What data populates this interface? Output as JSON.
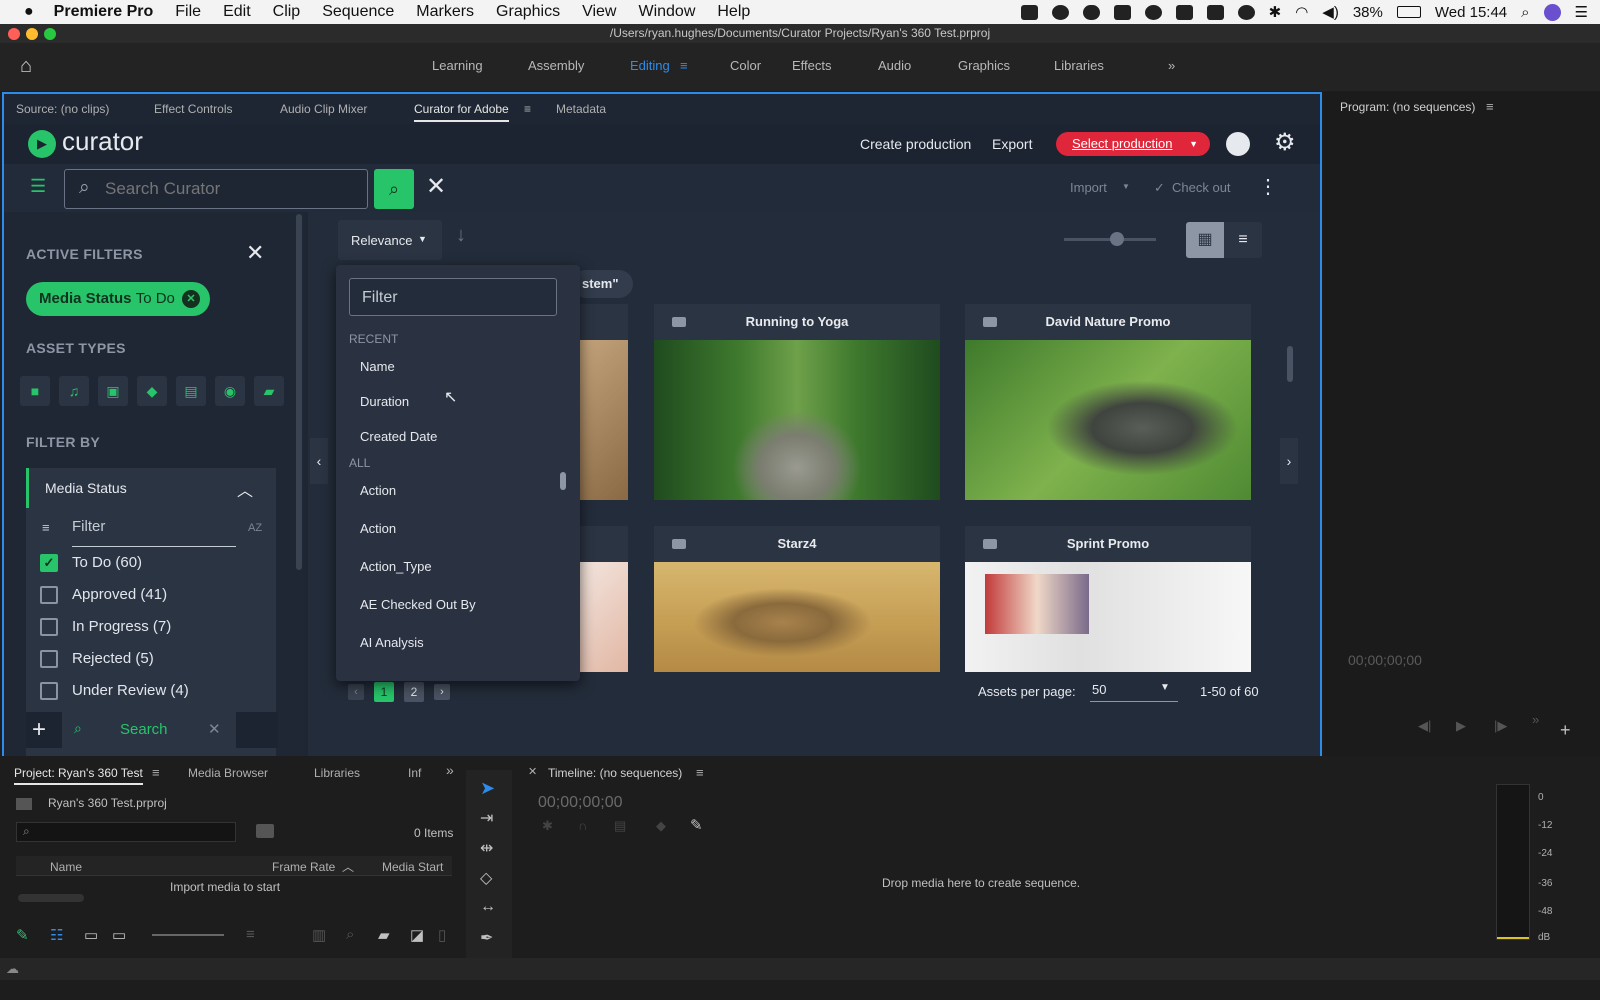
{
  "menubar": {
    "app": "Premiere Pro",
    "items": [
      "File",
      "Edit",
      "Clip",
      "Sequence",
      "Markers",
      "Graphics",
      "View",
      "Window",
      "Help"
    ],
    "battery": "38%",
    "clock": "Wed 15:44"
  },
  "window": {
    "title": "/Users/ryan.hughes/Documents/Curator Projects/Ryan's 360 Test.prproj"
  },
  "workspaces": {
    "items": [
      "Learning",
      "Assembly",
      "Editing",
      "Color",
      "Effects",
      "Audio",
      "Graphics",
      "Libraries"
    ],
    "active": "Editing"
  },
  "source_panel": {
    "tabs": [
      "Source: (no clips)",
      "Effect Controls",
      "Audio Clip Mixer",
      "Curator for Adobe",
      "Metadata"
    ],
    "active_tab": "Curator for Adobe"
  },
  "curator": {
    "logo": "curator",
    "create_production": "Create production",
    "export": "Export",
    "select_production": "Select production",
    "search_placeholder": "Search Curator",
    "import": "Import",
    "check_out": "Check out"
  },
  "filters": {
    "active_filters_title": "ACTIVE FILTERS",
    "chip_field": "Media Status",
    "chip_value": "To Do",
    "asset_types_title": "ASSET TYPES",
    "filter_by_title": "FILTER BY",
    "group_title": "Media Status",
    "filter_placeholder": "Filter",
    "sort_icon": "AZ",
    "options": [
      {
        "label": "To Do",
        "count": "(60)",
        "checked": true
      },
      {
        "label": "Approved",
        "count": "(41)",
        "checked": false
      },
      {
        "label": "In Progress",
        "count": "(7)",
        "checked": false
      },
      {
        "label": "Rejected",
        "count": "(5)",
        "checked": false
      },
      {
        "label": "Under Review",
        "count": "(4)",
        "checked": false
      }
    ],
    "search_button": "Search"
  },
  "sort": {
    "label": "Relevance",
    "dropdown": {
      "filter_placeholder": "Filter",
      "recent_header": "RECENT",
      "recent": [
        "Name",
        "Duration",
        "Created Date"
      ],
      "all_header": "ALL",
      "all": [
        "Action",
        "Action",
        "Action_Type",
        "AE Checked Out By",
        "AI Analysis"
      ]
    }
  },
  "search_tag": "stem\"",
  "assets": [
    {
      "title": "Running to Yoga",
      "thumb": "forest-path"
    },
    {
      "title": "David Nature Promo",
      "thumb": "nature-green"
    },
    {
      "title": "Starz4",
      "thumb": "lioness"
    },
    {
      "title": "Sprint Promo",
      "thumb": "white-studio"
    }
  ],
  "pagination": {
    "pages": [
      "1",
      "2"
    ],
    "current": "1",
    "per_page_label": "Assets per page:",
    "per_page": "50",
    "range": "1-50 of 60"
  },
  "program": {
    "title": "Program: (no sequences)",
    "timecode": "00;00;00;00"
  },
  "project": {
    "tabs": [
      "Project: Ryan's 360 Test",
      "Media Browser",
      "Libraries",
      "Inf"
    ],
    "file": "Ryan's 360 Test.prproj",
    "items": "0 Items",
    "columns": [
      "Name",
      "Frame Rate",
      "Media Start"
    ],
    "empty": "Import media to start"
  },
  "timeline": {
    "title": "Timeline: (no sequences)",
    "timecode": "00;00;00;00",
    "empty": "Drop media here to create sequence."
  },
  "meter": {
    "scale": [
      "0",
      "-12",
      "-24",
      "-36",
      "-48",
      "dB"
    ]
  },
  "colors": {
    "accent": "#27c46a",
    "blue": "#2d8ceb",
    "red": "#e0263b"
  }
}
